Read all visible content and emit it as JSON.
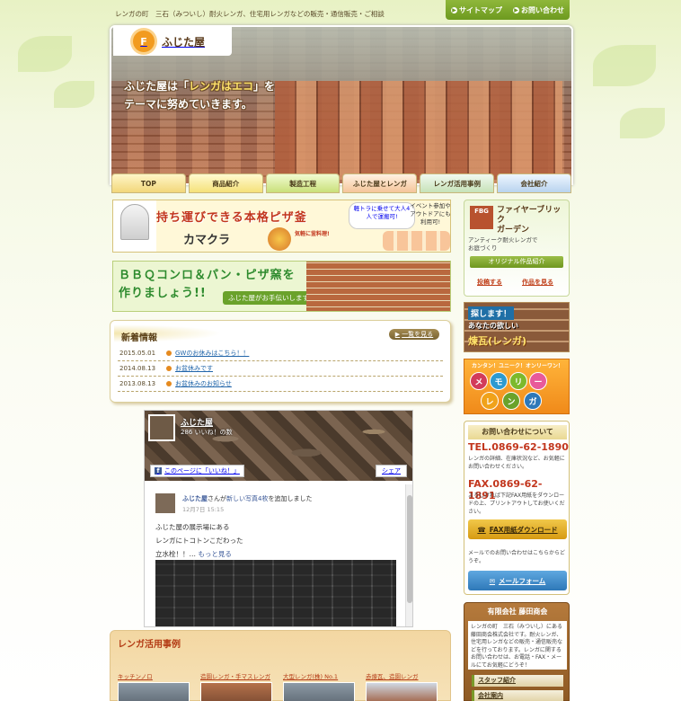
{
  "tagline": "レンガの町　三石（みついし）耐火レンガ、住宅用レンガなどの販売・通信販売・ご相談",
  "top_links": {
    "sitemap": "サイトマップ",
    "contact": "お問い合わせ"
  },
  "logo": {
    "mark": "F",
    "name": "ふじた屋"
  },
  "catch": {
    "line1a": "ふじた屋は「",
    "line1b": "レンガはエコ",
    "line1c": "」を",
    "line2": "テーマに努めていきます。"
  },
  "nav": [
    "TOP",
    "商品紹介",
    "製造工程",
    "ふじた屋とレンガ",
    "レンガ活用事例",
    "会社紹介"
  ],
  "banner_kamakura": {
    "headline": "持ち運びできる本格ピザ釜",
    "name": "カマクラ",
    "note1": "軽トラに乗せて大人4人で運搬可!",
    "note2": "イベント参加やアウトドアにも利用可!",
    "free": "気軽に釜料理!"
  },
  "banner_bbq": {
    "line1": "ＢＢＱコンロ＆パン・ピザ窯を",
    "line2": "作りましょう!!",
    "help": "ふじた屋がお手伝いします"
  },
  "news": {
    "title": "新着情報",
    "more": "一覧を見る",
    "items": [
      {
        "date": "2015.05.01",
        "text": "GWのお休みはこちら！！"
      },
      {
        "date": "2014.08.13",
        "text": "お盆休みです"
      },
      {
        "date": "2013.08.13",
        "text": "お盆休みのお知らせ"
      }
    ]
  },
  "facebook": {
    "page_name": "ふじた屋",
    "likes": "286 いいね！の数",
    "like_button": "このページに「いいね！」",
    "share_button": "シェア",
    "post_author": "ふじた屋",
    "post_action_pre": "さんが",
    "post_action_link": "新しい写真4枚",
    "post_action_post": "を追加しました",
    "post_date": "12月7日 15:15",
    "post_line1": "ふじた屋の展示場にある",
    "post_line2": "レンガにトコトンこだわった",
    "post_line3": "立水栓！！…",
    "see_more": "もっと見る"
  },
  "cases": {
    "title": "レンガ活用事例",
    "items": [
      "キッチンノロ",
      "造園レンガ・手マスレンガ",
      "大型レンガ(株) No.1",
      "赤煉瓦、造園レンガ"
    ]
  },
  "sidebar": {
    "garden": {
      "badge": "FBG",
      "title_l1": "ファイヤーブリック",
      "title_l2": "ガーデン",
      "desc_l1": "アンティーク耐火レンガで",
      "desc_l2": "お庭づくり",
      "orig": "オリジナル作品紹介",
      "submit": "投稿する",
      "view": "作品を見る"
    },
    "find": {
      "label": "探します！",
      "sub": "あなたの欲しい",
      "main": "煉瓦(レンガ)"
    },
    "memory": {
      "top": "カンタン！ユニーク！オンリーワン！",
      "chars": [
        "メ",
        "モ",
        "リ",
        "ー",
        "レ",
        "ン",
        "ガ"
      ]
    },
    "contact": {
      "title": "お問い合わせについて",
      "tel": "TEL.0869-62-1890",
      "tel_note": "レンガの詳細、在庫状況など、お気軽にお問い合わせください。",
      "fax": "FAX.0869-62-1891",
      "fax_note": "よろしければ下記FAX用紙をダウンロードの上、プリントアウトしてお使いください。",
      "fax_button": "FAX用紙ダウンロード",
      "mail_note": "メールでのお問い合わせはこちらからどうぞ。",
      "mail_button": "メールフォーム"
    },
    "company": {
      "title": "有限会社 藤田商会",
      "desc": "レンガの町　三石（みついし）にある藤田商会株式会社です。耐火レンガ、住宅用レンガなどの販売・通信販売などを行っております。レンガに関するお問い合わせは、お電話・FAX・メールにてお気軽にどうぞ！",
      "staff": "スタッフ紹介",
      "about": "会社案内"
    }
  },
  "colors": {
    "brand_green": "#6d9a1f",
    "brick_red": "#c2361d",
    "orange": "#f29b1f"
  }
}
